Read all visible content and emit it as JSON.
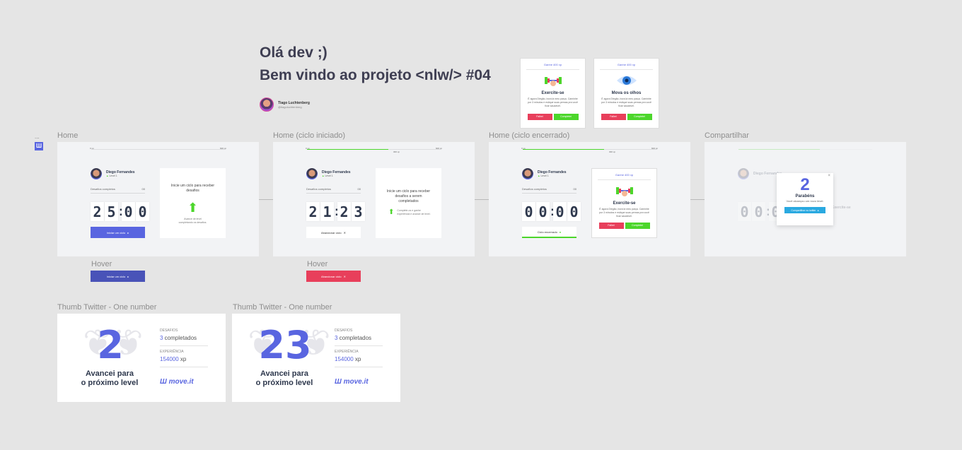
{
  "header": {
    "line1": "Olá dev ;)",
    "line2": "Bem vindo ao projeto <nlw/> #04",
    "author_name": "Tiago Luchtenberg",
    "author_handle": "@tiagoluchtenberg"
  },
  "sidebar": {
    "dots": "...",
    "logo_glyph": "Ш"
  },
  "challenge_cards": [
    {
      "gain": "Ganhe 400 xp",
      "title": "Exercite-se",
      "desc": "É agora Diegão, bora lá meu parça. Caminhe por 3 minutos e estique suas pernas pra você ficar saudável.",
      "fail": "Falhei",
      "done": "Completei"
    },
    {
      "gain": "Ganhe 400 xp",
      "title": "Mova os olhos",
      "desc": "É agora Diegão, bora lá meu parça. Caminhe por 3 minutos e estique suas pernas pra você ficar saudável.",
      "fail": "Falhei",
      "done": "Completei"
    }
  ],
  "frames": [
    {
      "label": "Home",
      "xp_start": "0 xp",
      "xp_end": "600 xp",
      "name": "Diego Fernandes",
      "level": "Level 1",
      "completed_label": "Desafios completos",
      "completed_value": "00",
      "timer": [
        "2",
        "5",
        "0",
        "0"
      ],
      "button": "Iniciar um ciclo",
      "box_title": "Inicie um ciclo para receber desafios",
      "box_hint": "Avance de level completando os desafios."
    },
    {
      "label": "Home (ciclo iniciado)",
      "xp_start": "0 xp",
      "xp_end": "600 xp",
      "xp_mid": "300 xp",
      "name": "Diego Fernandes",
      "level": "Level 1",
      "completed_label": "Desafios completos",
      "completed_value": "00",
      "timer": [
        "2",
        "1",
        "2",
        "3"
      ],
      "button": "Abandonar ciclo",
      "box_title": "Inicie um ciclo para receber desafios a serem completados",
      "box_hint": "Complete-os e ganhe experiência e avance de level."
    },
    {
      "label": "Home (ciclo encerrado)",
      "xp_start": "0 xp",
      "xp_end": "600 xp",
      "xp_mid": "300 xp",
      "name": "Diego Fernandes",
      "level": "Level 1",
      "completed_label": "Desafios completos",
      "completed_value": "00",
      "timer": [
        "0",
        "0",
        "0",
        "0"
      ],
      "button": "Ciclo encerrado",
      "gain": "Ganhe 400 xp",
      "box_title": "Exercite-se",
      "box_hint": "É agora Diegão, bora lá meu parça. Caminhe por 3 minutos e estique suas pernas pra você ficar saudável.",
      "fail": "Falhei",
      "done": "Completei"
    },
    {
      "label": "Compartilhar",
      "modal_number": "2",
      "modal_title": "Parabéns",
      "modal_sub": "Você alcançou um novo level.",
      "modal_button": "Compartilhar no twitter",
      "bg_name": "Diego Fernandes",
      "bg_box_title": "Exercite-se",
      "close": "×",
      "bg_timer": [
        "0",
        "0",
        "0"
      ]
    }
  ],
  "hovers": [
    {
      "label": "Hover",
      "button": "Iniciar um ciclo",
      "color": "#4953b8"
    },
    {
      "label": "Hover",
      "button": "Abandonar ciclo",
      "color": "#e83f5b"
    }
  ],
  "thumbs": [
    {
      "label": "Thumb Twitter - One number",
      "number": "2",
      "line1": "Avancei para",
      "line2": "o próximo level",
      "desafios_label": "DESAFIOS",
      "desafios_num": "3",
      "desafios_text": " completados",
      "exp_label": "EXPERIÊNCIA",
      "exp_num": "154000",
      "exp_unit": " xp",
      "brand": "move.it",
      "brand_icon": "Ш"
    },
    {
      "label": "Thumb Twitter - One number",
      "number": "23",
      "line1": "Avancei para",
      "line2": "o próximo level",
      "desafios_label": "DESAFIOS",
      "desafios_num": "3",
      "desafios_text": " completados",
      "exp_label": "EXPERIÊNCIA",
      "exp_num": "154000",
      "exp_unit": " xp",
      "brand": "move.it",
      "brand_icon": "Ш"
    }
  ],
  "colors": {
    "primary": "#5965e0",
    "green": "#4cd62b",
    "red": "#e83f5b",
    "twitter": "#2aa9e0"
  }
}
